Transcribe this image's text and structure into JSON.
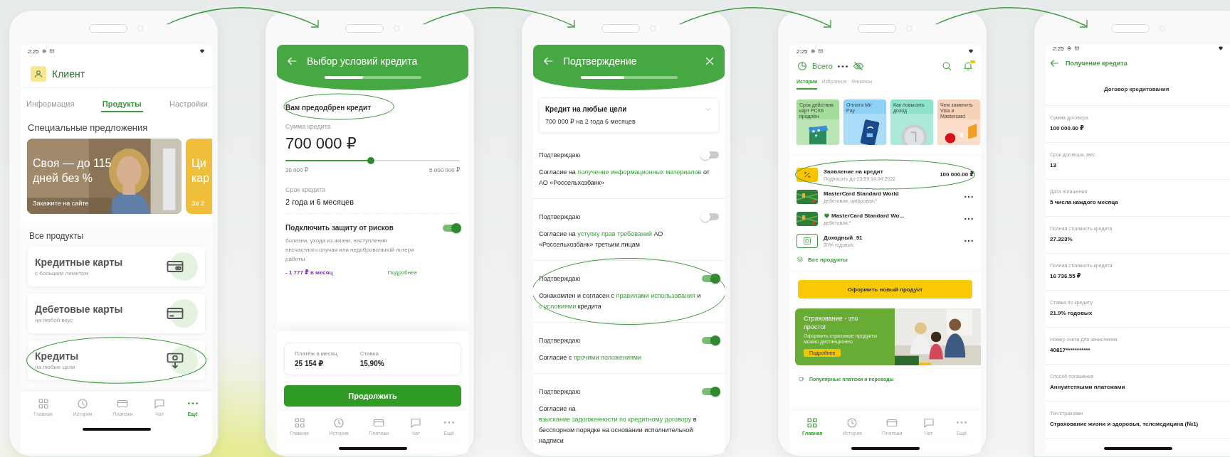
{
  "phones": [
    {
      "kind": "client_profile",
      "status_bar": {
        "time": "2:25"
      },
      "profile": {
        "name": "Клиент"
      },
      "tabs": [
        {
          "label": "Информация",
          "selected": false
        },
        {
          "label": "Продукты",
          "selected": true
        },
        {
          "label": "Настройки",
          "selected": false
        }
      ],
      "offers_title": "Специальные предложения",
      "offers": [
        {
          "kind": "picture",
          "title_lines": [
            "Своя — до 115",
            "дней без %"
          ],
          "caption": "Закажите на сайте"
        },
        {
          "kind": "plain",
          "title_lines": [
            "Ци",
            "кар"
          ],
          "caption": "За 2"
        }
      ],
      "products_title": "Все продукты",
      "products": [
        {
          "kind": "credit_card",
          "title": "Кредитные карты",
          "subtitle": "с большим лимитом",
          "highlighted": false
        },
        {
          "kind": "debit_card",
          "title": "Дебетовые карты",
          "subtitle": "на любой вкус",
          "highlighted": false
        },
        {
          "kind": "loan",
          "title": "Кредиты",
          "subtitle": "на любые цели",
          "highlighted": true
        }
      ],
      "bottom_nav": [
        {
          "label": "Главная",
          "selected": false
        },
        {
          "label": "История",
          "selected": false
        },
        {
          "label": "Платежи",
          "selected": false
        },
        {
          "label": "Чат",
          "selected": false
        },
        {
          "label": "Ещё",
          "selected": true
        }
      ]
    },
    {
      "kind": "loan_terms",
      "header": {
        "title": "Выбор условий кредита",
        "progress": {
          "level": 0.4
        }
      },
      "approved_note": {
        "text": "Вам предодбрен кредит",
        "highlighted": true
      },
      "amount": {
        "label": "Сумма кредита",
        "value": "700 000 ₽",
        "slider": {
          "level": 0.49
        },
        "min": "30 000 ₽",
        "max": "5 000 000 ₽"
      },
      "term": {
        "label": "Срок кредита",
        "value": "2 года и 6 месяцев"
      },
      "protection": {
        "title": "Подключить защиту от рисков",
        "on": true,
        "description": "болезни, ухода из жизни, наступления несчастного случая или недобровольной потери работы",
        "price": "- 1 777 ₽ в месяц",
        "link": "Подробнее"
      },
      "summary": [
        {
          "label": "Платёж в месяц",
          "value": "25 154 ₽"
        },
        {
          "label": "Ставка",
          "value": "15,90%"
        }
      ],
      "continue_button": "Продолжить",
      "bottom_nav": [
        {
          "label": "Главная",
          "selected": false
        },
        {
          "label": "История",
          "selected": false
        },
        {
          "label": "Платежи",
          "selected": false
        },
        {
          "label": "Чат",
          "selected": false
        },
        {
          "label": "Ещё",
          "selected": false
        }
      ]
    },
    {
      "kind": "confirmation",
      "header": {
        "title": "Подтверждение",
        "progress": {
          "level": 0.45
        }
      },
      "loan_card": {
        "title": "Кредит на любые цели",
        "subtitle": "700 000 ₽ на 2 года 6 месяцев"
      },
      "consents": [
        {
          "label": "Подтверждаю",
          "on": false,
          "highlighted": false,
          "text": [
            {
              "kind": "plain",
              "text": "Согласие на "
            },
            {
              "kind": "link",
              "text": "получение  информационных материалов"
            },
            {
              "kind": "plain",
              "text": " от АО «Россельхозбанк»"
            }
          ]
        },
        {
          "label": "Подтверждаю",
          "on": false,
          "highlighted": false,
          "text": [
            {
              "kind": "plain",
              "text": "Согласие на "
            },
            {
              "kind": "link",
              "text": "уступку прав требований"
            },
            {
              "kind": "plain",
              "text": " АО «Россельхозбанк» третьим лицам"
            }
          ]
        },
        {
          "label": "Подтверждаю",
          "on": true,
          "highlighted": true,
          "text": [
            {
              "kind": "plain",
              "text": "Ознакомлен и согласен с "
            },
            {
              "kind": "link",
              "text": "правилами использования"
            },
            {
              "kind": "plain",
              "text": " и "
            },
            {
              "kind": "link",
              "text": "с условиями"
            },
            {
              "kind": "plain",
              "text": " кредита"
            }
          ]
        },
        {
          "label": "Подтверждаю",
          "on": true,
          "highlighted": false,
          "text": [
            {
              "kind": "plain",
              "text": "Согласие с "
            },
            {
              "kind": "link",
              "text": "прочими положениями"
            }
          ]
        },
        {
          "label": "Подтверждаю",
          "on": true,
          "highlighted": false,
          "text": [
            {
              "kind": "plain",
              "text": "Согласие на "
            },
            {
              "kind": "link",
              "text": "взыскание задолженности по кредитному договору"
            },
            {
              "kind": "plain",
              "text": " в бесспорном порядке на основании исполнительной надписи"
            }
          ]
        }
      ]
    },
    {
      "kind": "home",
      "status_bar": {
        "time": "2:25"
      },
      "header": {
        "title": "Всего",
        "notification_badge": true
      },
      "tabs": [
        {
          "label": "Истории",
          "selected": true
        },
        {
          "label": "Избранное",
          "selected": false
        },
        {
          "label": "Финансы",
          "selected": false
        }
      ],
      "stories": [
        {
          "kind": "cards",
          "text": "Срок действия карт РСХБ продлён"
        },
        {
          "kind": "phone",
          "text": "Оплата Mir Pay"
        },
        {
          "kind": "coin",
          "text": "Как повысить доход"
        },
        {
          "kind": "swap",
          "text": "Чем заменить Visa и Mastercard"
        }
      ],
      "products": [
        {
          "kind": "application",
          "title": "Заявление на кредит",
          "subtitle": "Подписать до 23:59 14.04.2022",
          "amount": "100 000.00 ₽",
          "favorite": false,
          "highlighted": true
        },
        {
          "kind": "card",
          "title": "MasterCard Standard World",
          "subtitle": "дебетовая, цифровая,*",
          "favorite": false,
          "highlighted": false
        },
        {
          "kind": "card",
          "title": "MasterCard Standard Wo...",
          "subtitle": "дебетовая,*",
          "favorite": true,
          "highlighted": false
        },
        {
          "kind": "deposit",
          "title": "Доходный_91",
          "subtitle": "20% годовых",
          "favorite": false,
          "highlighted": false
        }
      ],
      "all_products_link": "Все продукты",
      "new_product_button": "Оформить новый продукт",
      "banner": {
        "title": "Страхование - это просто!",
        "text": "Оформить страховые продукты можно дистанционно",
        "button": "Подробнее"
      },
      "popular_title": "Популярные платежи и переводы",
      "bottom_nav": [
        {
          "label": "Главная",
          "selected": true
        },
        {
          "label": "История",
          "selected": false
        },
        {
          "label": "Платежи",
          "selected": false
        },
        {
          "label": "Чат",
          "selected": false
        },
        {
          "label": "Ещё",
          "selected": false
        }
      ]
    },
    {
      "kind": "contract",
      "status_bar": {
        "time": "2:25"
      },
      "header": {
        "title": "Получение кредита"
      },
      "section_title": "Договор кредитования",
      "fields": [
        {
          "label": "Сумма договора",
          "value": "100 000.00 ₽"
        },
        {
          "label": "Срок договора, мес",
          "value": "13"
        },
        {
          "label": "Дата погашения",
          "value": "5 числа каждого месяца"
        },
        {
          "label": "Полная стоимость кредита",
          "value": "27.323%"
        },
        {
          "label": "Полная стоимость кредита",
          "value": "16 736.55 ₽"
        },
        {
          "label": "Ставка по кредиту",
          "value": "21.9% годовых"
        },
        {
          "label": "Номер счета для зачисления",
          "value": "40817***********"
        },
        {
          "label": "Способ погашения",
          "value": "Аннуитетными платежами"
        },
        {
          "label": "Тип страховки",
          "value": "Страхование жизни и здоровья, телемедицина (№1)"
        }
      ]
    }
  ]
}
